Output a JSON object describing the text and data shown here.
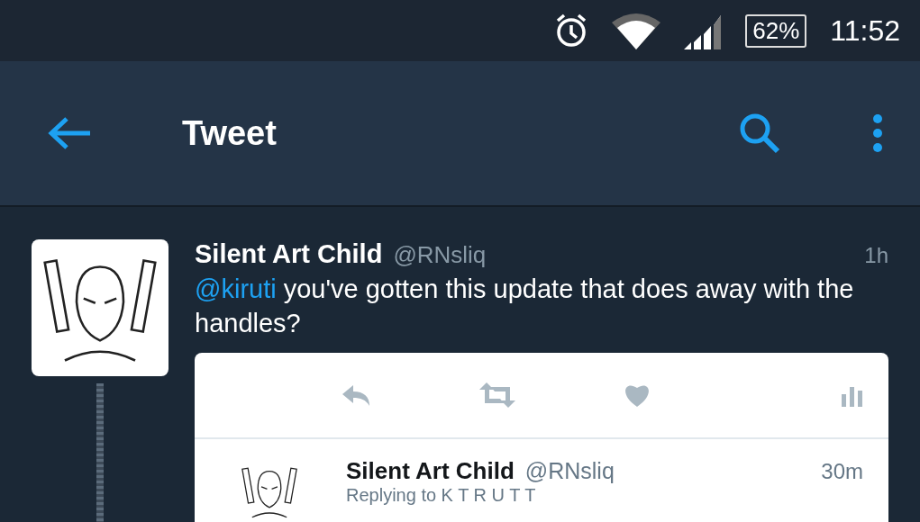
{
  "status_bar": {
    "battery": "62%",
    "time": "11:52"
  },
  "toolbar": {
    "title": "Tweet"
  },
  "tweet": {
    "name": "Silent Art Child",
    "handle": "@RNsliq",
    "time": "1h",
    "mention": "@kiruti",
    "text": " you've gotten this update that does away with the handles?",
    "quoted": {
      "name": "Silent Art Child",
      "handle": "@RNsliq",
      "time": "30m",
      "replying": "Replying to K T R U T T"
    }
  }
}
